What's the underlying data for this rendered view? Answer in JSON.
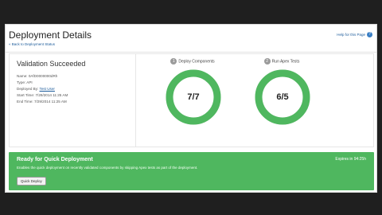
{
  "header": {
    "title": "Deployment Details",
    "back_link": "« Back to Deployment Status",
    "help_link": "Help for this Page",
    "help_icon": "question-icon"
  },
  "status": {
    "title": "Validation Succeeded",
    "details": [
      {
        "label": "Name:",
        "value": "0AfD0000000dRh"
      },
      {
        "label": "Type:",
        "value": "API"
      },
      {
        "label": "Deployed By:",
        "value": "Test User"
      },
      {
        "label": "Start Time:",
        "value": "7/29/2014 11:25 AM"
      },
      {
        "label": "End Time:",
        "value": "7/29/2014 11:25 AM"
      }
    ]
  },
  "stats": [
    {
      "num": "1",
      "label": "Deploy Components",
      "value": "7/7",
      "done": 7,
      "total": 7
    },
    {
      "num": "2",
      "label": "Run Apex Tests",
      "value": "6/5",
      "done": 6,
      "total": 6
    }
  ],
  "banner": {
    "title": "Ready for Quick Deployment",
    "text": "Enables the quick deployment on recently validated components by skipping Apex tests as part of the deployment.",
    "expiry": "Expires in 94:25h",
    "button": "Quick Deploy"
  },
  "colors": {
    "success": "#4fb75f",
    "ring_track": "#dcdcdc",
    "link": "#1a5a9a"
  }
}
